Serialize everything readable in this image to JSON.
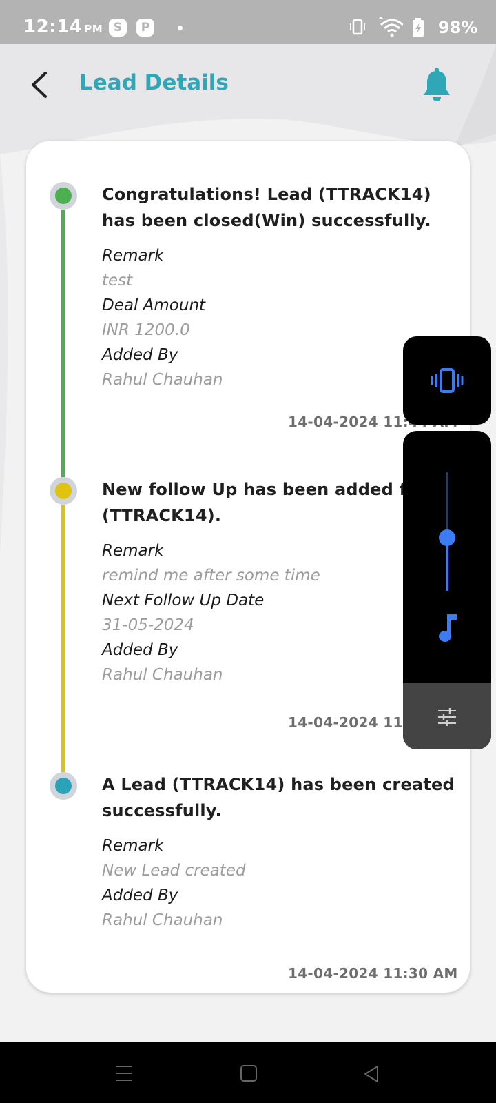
{
  "status_bar": {
    "time": "12:14",
    "ampm": "PM",
    "notification_icons": [
      "S",
      "P"
    ],
    "battery": "98%"
  },
  "header": {
    "title": "Lead Details",
    "back_icon": "chevron-left-icon",
    "bell_icon": "bell-icon",
    "accent_color": "#2fa7b6"
  },
  "timeline": [
    {
      "title": "Congratulations! Lead (TTRACK14) has been closed(Win) successfully.",
      "dot_color": "#4caf50",
      "fields": [
        {
          "label": "Remark",
          "value": "test"
        },
        {
          "label": "Deal Amount",
          "value": "INR 1200.0"
        },
        {
          "label": "Added By",
          "value": "Rahul  Chauhan"
        }
      ],
      "timestamp": "14-04-2024 11:44 AM"
    },
    {
      "title": "New follow Up has been added for (TTRACK14).",
      "dot_color": "#e0c30f",
      "fields": [
        {
          "label": "Remark",
          "value": "remind me after some time"
        },
        {
          "label": "Next Follow Up Date",
          "value": "31-05-2024"
        },
        {
          "label": "Added By",
          "value": "Rahul  Chauhan"
        }
      ],
      "timestamp": "14-04-2024 11:"
    },
    {
      "title": "A Lead (TTRACK14) has been created successfully.",
      "dot_color": "#2aa3b8",
      "fields": [
        {
          "label": "Remark",
          "value": "New Lead created"
        },
        {
          "label": "Added By",
          "value": "Rahul  Chauhan"
        }
      ],
      "timestamp": "14-04-2024 11:30 AM"
    }
  ],
  "volume_overlay": {
    "mode_icon": "vibrate-icon",
    "media_icon": "music-note-icon",
    "settings_icon": "sliders-icon",
    "level": 0.45,
    "accent_color": "#3b7cf5"
  },
  "nav_bar": {
    "icons": [
      "menu-icon",
      "home-icon",
      "back-icon"
    ]
  }
}
